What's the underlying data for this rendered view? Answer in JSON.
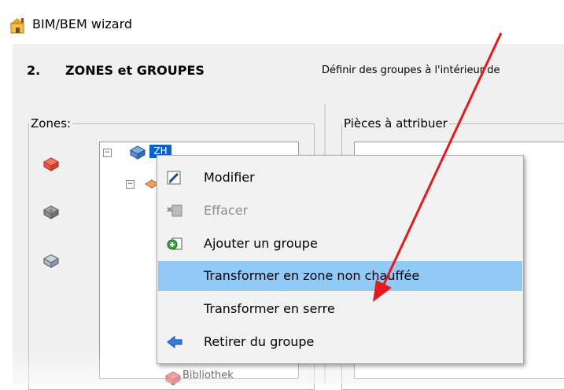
{
  "window": {
    "title": "BIM/BEM wizard"
  },
  "header": {
    "step_number": "2.",
    "step_title": "ZONES et GROUPES",
    "step_description": "Définir des groupes à l'intérieur de"
  },
  "zones_panel": {
    "legend": "Zones:"
  },
  "pieces_panel": {
    "legend": "Pièces à attribuer"
  },
  "tree": {
    "selected_label": "ZH",
    "partial_item_label": "Bibliothek"
  },
  "context_menu": {
    "items": [
      {
        "label": "Modifier",
        "icon": "edit-icon",
        "enabled": true
      },
      {
        "label": "Effacer",
        "icon": "delete-icon",
        "enabled": false
      },
      {
        "label": "Ajouter un groupe",
        "icon": "add-group-icon",
        "enabled": true
      },
      {
        "label": "Transformer en zone non chauffée",
        "icon": "",
        "enabled": true,
        "highlighted": true
      },
      {
        "label": "Transformer en serre",
        "icon": "",
        "enabled": true
      },
      {
        "label": "Retirer du groupe",
        "icon": "arrow-left-icon",
        "enabled": true
      }
    ]
  },
  "annotation": {
    "arrow_color": "#e8191c"
  },
  "colors": {
    "highlight": "#91c9f7",
    "selection": "#0a64c8",
    "panel_bg": "#f0f0f0"
  }
}
